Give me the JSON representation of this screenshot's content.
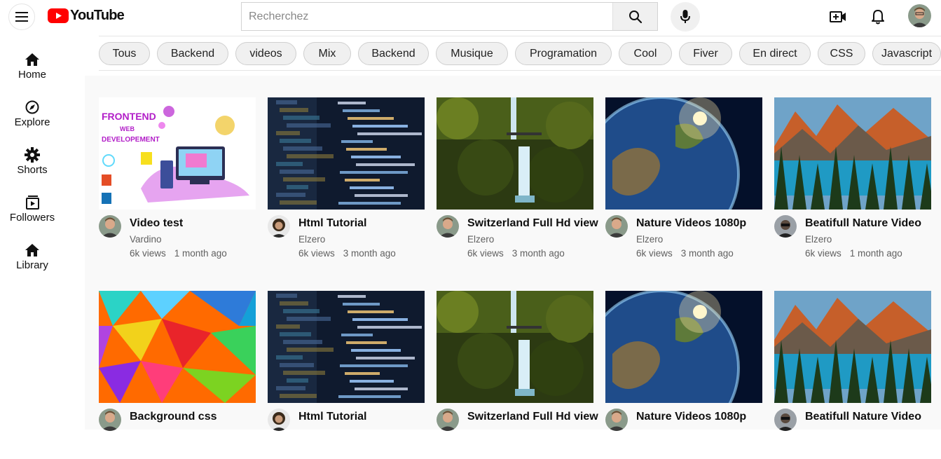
{
  "header": {
    "logo_text": "YouTube",
    "search_placeholder": "Recherchez"
  },
  "sidebar": {
    "items": [
      {
        "label": "Home",
        "icon": "home-icon"
      },
      {
        "label": "Explore",
        "icon": "compass-icon"
      },
      {
        "label": "Shorts",
        "icon": "gear-icon"
      },
      {
        "label": "Followers",
        "icon": "subscriptions-icon"
      },
      {
        "label": "Library",
        "icon": "home-icon"
      }
    ]
  },
  "chips": [
    "Tous",
    "Backend",
    "videos",
    "Mix",
    "Backend",
    "Musique",
    "Programation",
    "Cool",
    "Fiver",
    "En direct",
    "CSS",
    "Javascript"
  ],
  "videos": [
    {
      "title": "Video test",
      "channel": "Vardino",
      "views": "6k views",
      "age": "1 month ago",
      "thumb": "frontend"
    },
    {
      "title": "Html Tutorial",
      "channel": "Elzero",
      "views": "6k views",
      "age": "3 month ago",
      "thumb": "code"
    },
    {
      "title": "Switzerland Full Hd view",
      "channel": "Elzero",
      "views": "6k views",
      "age": "3 month ago",
      "thumb": "waterfall"
    },
    {
      "title": "Nature Videos 1080p",
      "channel": "Elzero",
      "views": "6k views",
      "age": "3 month ago",
      "thumb": "earth"
    },
    {
      "title": "Beatifull Nature Video",
      "channel": "Elzero",
      "views": "6k views",
      "age": "1 month ago",
      "thumb": "lake"
    },
    {
      "title": "Background css",
      "channel": "",
      "views": "",
      "age": "",
      "thumb": "poly"
    },
    {
      "title": "Html Tutorial",
      "channel": "",
      "views": "",
      "age": "",
      "thumb": "code"
    },
    {
      "title": "Switzerland Full Hd view",
      "channel": "",
      "views": "",
      "age": "",
      "thumb": "waterfall"
    },
    {
      "title": "Nature Videos 1080p",
      "channel": "",
      "views": "",
      "age": "",
      "thumb": "earth"
    },
    {
      "title": "Beatifull Nature Video",
      "channel": "",
      "views": "",
      "age": "",
      "thumb": "lake"
    }
  ],
  "colors": {
    "brand_red": "#ff0000",
    "text_secondary": "#606060",
    "chip_bg": "#f0f0f0"
  }
}
